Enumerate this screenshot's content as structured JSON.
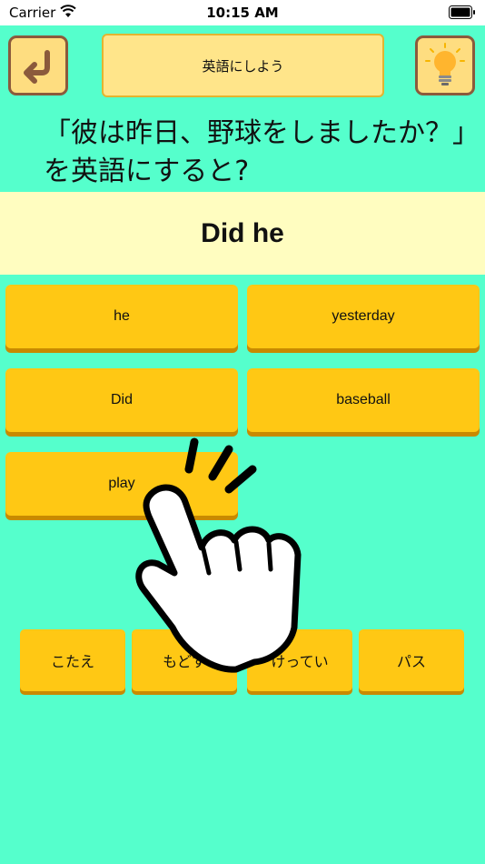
{
  "status_bar": {
    "carrier": "Carrier",
    "time": "10:15 AM"
  },
  "header": {
    "title": "英語にしよう",
    "back_icon": "back-arrow-icon",
    "hint_icon": "lightbulb-icon"
  },
  "question": {
    "text": "「彼は昨日、野球をしましたか？」を英語にすると?"
  },
  "answer": {
    "text": "Did he"
  },
  "words": [
    "he",
    "yesterday",
    "Did",
    "baseball",
    "play"
  ],
  "controls": {
    "answer": "こたえ",
    "undo": "もどす",
    "confirm": "けってい",
    "pass": "パス"
  },
  "colors": {
    "background": "#55ffcc",
    "button": "#ffc814",
    "answer_band": "#fffdc0"
  }
}
